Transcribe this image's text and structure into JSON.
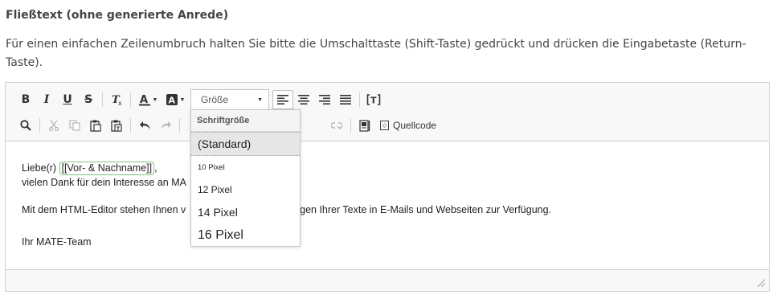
{
  "section": {
    "title": "Fließtext (ohne generierte Anrede)",
    "hint": "Für einen einfachen Zeilenumbruch halten Sie bitte die Umschalttaste (Shift-Taste) gedrückt und drücken die Eingabetaste (Return-Taste)."
  },
  "toolbar": {
    "bold": "B",
    "italic": "I",
    "underline": "U",
    "strike": "S",
    "font_size_combo": "Größe",
    "source_label": "Quellcode"
  },
  "icons": {
    "bold": "bold-icon",
    "italic": "italic-icon",
    "underline": "underline-icon",
    "strike": "strikethrough-icon",
    "remove_format": "remove-format-icon",
    "text_color": "text-color-icon",
    "bg_color": "background-color-icon",
    "align_left": "align-left-icon",
    "align_center": "align-center-icon",
    "align_right": "align-right-icon",
    "justify": "justify-icon",
    "placeholder": "placeholder-icon",
    "find": "search-icon",
    "cut": "cut-icon",
    "copy": "copy-icon",
    "paste": "paste-icon",
    "paste_text": "paste-text-icon",
    "undo": "undo-icon",
    "redo": "redo-icon",
    "unlink": "unlink-icon",
    "page": "page-icon",
    "source": "source-icon"
  },
  "content": {
    "greeting_prefix": "Liebe(r)",
    "placeholder_tag": "[[Vor- & Nachname]]",
    "greeting_suffix": ",",
    "line2": "vielen Dank für dein Interesse an MA",
    "para_left": "Mit dem HTML-Editor stehen Ihnen v",
    "para_right": "tellungen Ihrer Texte in E-Mails und Webseiten zur Verfügung.",
    "signature": "Ihr MATE-Team"
  },
  "font_size_dropdown": {
    "header": "Schriftgröße",
    "options": [
      "(Standard)",
      "10 Pixel",
      "12 Pixel",
      "14 Pixel",
      "16 Pixel"
    ],
    "selected": "(Standard)"
  },
  "colors": {
    "placeholder_border": "#7cc47c",
    "toolbar_bg": "#f8f8f8",
    "border": "#d1d1d1"
  }
}
